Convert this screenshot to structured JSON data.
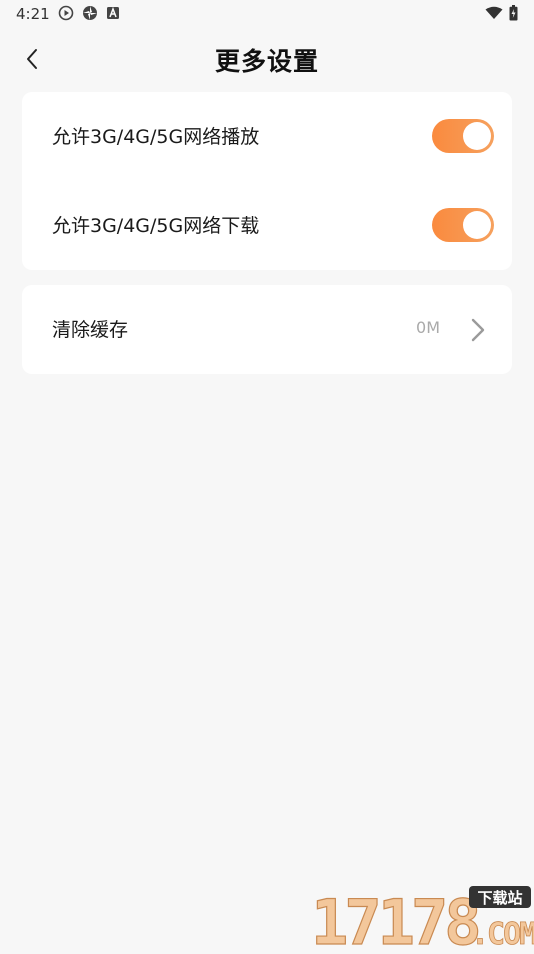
{
  "status_bar": {
    "time": "4:21",
    "left_icons": [
      "play-circle-icon",
      "pinwheel-icon",
      "a-badge-icon"
    ],
    "right_icons": [
      "wifi-icon",
      "battery-icon"
    ]
  },
  "header": {
    "title": "更多设置",
    "back_icon": "chevron-left-icon"
  },
  "settings": {
    "network_play": {
      "label": "允许3G/4G/5G网络播放",
      "enabled": true
    },
    "network_download": {
      "label": "允许3G/4G/5G网络下载",
      "enabled": true
    },
    "clear_cache": {
      "label": "清除缓存",
      "value": "0M"
    }
  },
  "colors": {
    "background": "#f7f7f7",
    "card": "#ffffff",
    "accent": "#fa8a3e"
  },
  "watermark": {
    "main": "17178",
    "suffix": ".COM",
    "tag": "下载站"
  }
}
